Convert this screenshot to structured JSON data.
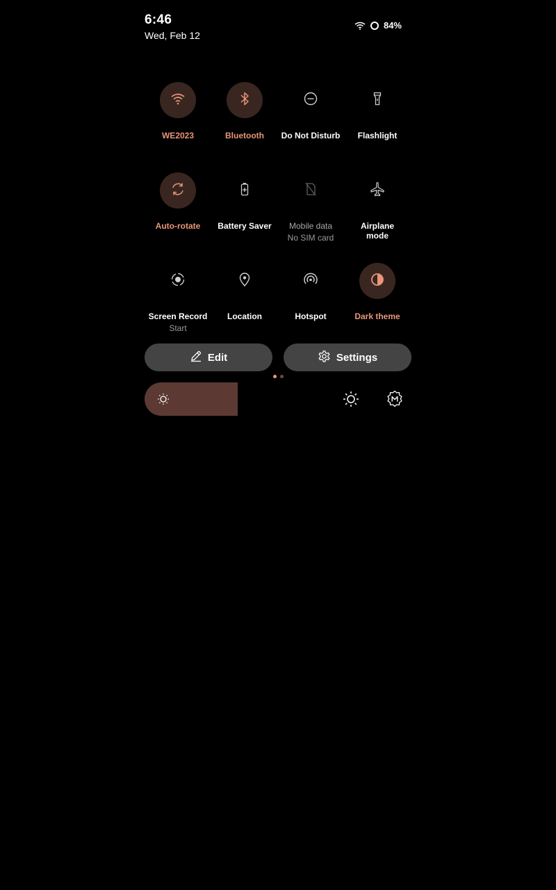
{
  "status_bar": {
    "time": "6:46",
    "date": "Wed, Feb 12",
    "battery_percent": "84%"
  },
  "accent_color": "#e8967a",
  "tiles": [
    {
      "label": "WE2023",
      "sub": "",
      "icon": "wifi-icon",
      "active": true
    },
    {
      "label": "Bluetooth",
      "sub": "",
      "icon": "bluetooth-icon",
      "active": true
    },
    {
      "label": "Do Not Disturb",
      "sub": "",
      "icon": "do-not-disturb-icon",
      "active": false
    },
    {
      "label": "Flashlight",
      "sub": "",
      "icon": "flashlight-icon",
      "active": false
    },
    {
      "label": "Auto-rotate",
      "sub": "",
      "icon": "auto-rotate-icon",
      "active": true
    },
    {
      "label": "Battery Saver",
      "sub": "",
      "icon": "battery-saver-icon",
      "active": false
    },
    {
      "label": "Mobile data",
      "sub": "No SIM card",
      "icon": "mobile-data-icon",
      "active": false
    },
    {
      "label": "Airplane mode",
      "sub": "",
      "icon": "airplane-icon",
      "active": false
    },
    {
      "label": "Screen Record",
      "sub": "Start",
      "icon": "screen-record-icon",
      "active": false
    },
    {
      "label": "Location",
      "sub": "",
      "icon": "location-icon",
      "active": false
    },
    {
      "label": "Hotspot",
      "sub": "",
      "icon": "hotspot-icon",
      "active": false
    },
    {
      "label": "Dark theme",
      "sub": "",
      "icon": "dark-theme-icon",
      "active": true
    }
  ],
  "actions": {
    "edit_label": "Edit",
    "settings_label": "Settings"
  },
  "pager": {
    "current_page": 1,
    "total_pages": 2
  },
  "brightness": {
    "level_fraction": 0.35
  }
}
